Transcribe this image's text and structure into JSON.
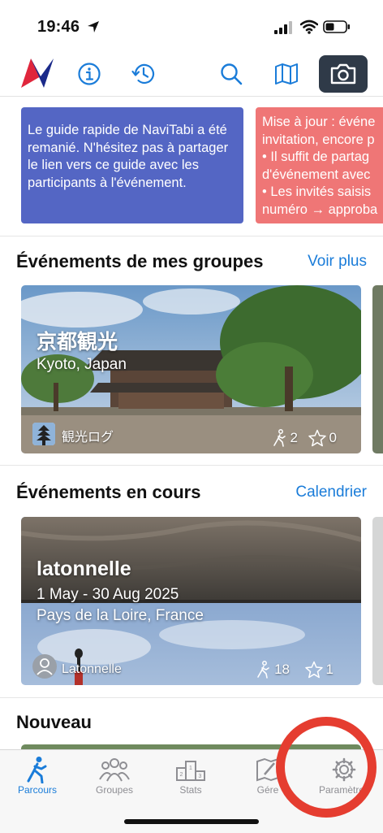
{
  "status_bar": {
    "time": "19:46"
  },
  "toolbar": {
    "icons": [
      "app-logo",
      "info-icon",
      "history-icon",
      "search-icon",
      "map-icon",
      "camera-icon"
    ]
  },
  "banners": [
    {
      "text": "Le guide rapide de NaviTabi a été remanié. N'hésitez pas à partager le lien vers ce guide avec les participants à l'événement.",
      "color": "#5466c4"
    },
    {
      "lines": [
        "Mise à jour : événe",
        "invitation, encore p",
        "• Il suffit de partag",
        "d'événement avec",
        "• Les invités saisis",
        "numéro → approba"
      ],
      "color": "#ef7676"
    }
  ],
  "groups_section": {
    "title": "Événements de mes groupes",
    "link": "Voir plus",
    "card": {
      "title": "京都観光",
      "location": "Kyoto, Japan",
      "owner": "観光ログ",
      "walkers": "2",
      "stars": "0"
    }
  },
  "current_section": {
    "title": "Événements en cours",
    "link": "Calendrier",
    "card": {
      "title": "latonnelle",
      "dates": "1 May - 30 Aug 2025",
      "location": "Pays de la Loire, France",
      "owner": "Latonnelle",
      "walkers": "18",
      "stars": "1"
    }
  },
  "new_section": {
    "title": "Nouveau"
  },
  "tabbar": {
    "tabs": [
      {
        "label": "Parcours",
        "icon": "walker-icon",
        "active": true
      },
      {
        "label": "Groupes",
        "icon": "group-icon",
        "active": false
      },
      {
        "label": "Stats",
        "icon": "podium-icon",
        "active": false
      },
      {
        "label": "Gére",
        "icon": "manage-icon",
        "active": false
      },
      {
        "label": "Paramètres",
        "icon": "gear-icon",
        "active": false
      }
    ]
  },
  "colors": {
    "accent": "#1a7cd9",
    "highlight_circle": "#e53d30",
    "camera_button": "#2f3a48"
  }
}
